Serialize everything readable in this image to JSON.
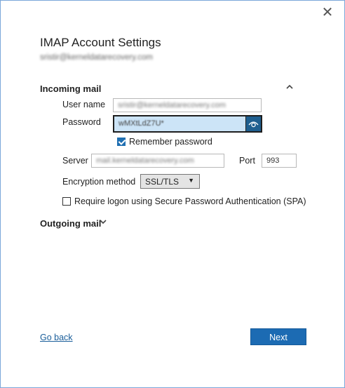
{
  "dialog": {
    "close_glyph": "✕",
    "title": "IMAP Account Settings",
    "account_email": "sristir@kerneldatarecovery.com"
  },
  "incoming": {
    "header": "Incoming mail",
    "username_label": "User name",
    "username_value": "sristir@kerneldatarecovery.com",
    "password_label": "Password",
    "password_value": "wMXtLdZ7U*",
    "remember_label": "Remember password",
    "remember_checked": true,
    "server_label": "Server",
    "server_value": "mail.kerneldatarecovery.com",
    "port_label": "Port",
    "port_value": "993",
    "encryption_label": "Encryption method",
    "encryption_value": "SSL/TLS",
    "spa_label": "Require logon using Secure Password Authentication (SPA)",
    "spa_checked": false
  },
  "outgoing": {
    "header": "Outgoing mail"
  },
  "footer": {
    "back_label": "Go back",
    "next_label": "Next"
  },
  "colors": {
    "accent": "#1c6bb3",
    "link": "#1a5e9a",
    "password_highlight": "#cce4f7"
  },
  "icons": {
    "close": "close-icon",
    "collapse": "chevron-up-icon",
    "expand": "chevron-down-icon",
    "reveal_password": "eye-icon",
    "dropdown": "chevron-down-icon"
  }
}
